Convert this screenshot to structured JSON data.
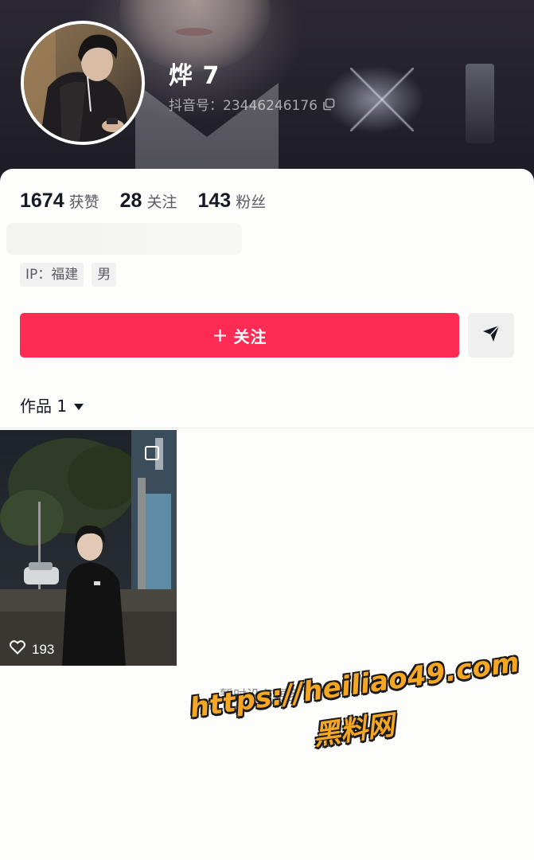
{
  "profile": {
    "nickname": "烨 7",
    "douyin_id": "抖音号：23446246176"
  },
  "stats": [
    {
      "value": "1674",
      "label": "获赞"
    },
    {
      "value": "28",
      "label": "关注"
    },
    {
      "value": "143",
      "label": "粉丝"
    }
  ],
  "tags": [
    "IP：福建",
    "男"
  ],
  "actions": {
    "follow_plus": "+",
    "follow_label": "关注"
  },
  "works_tab": {
    "label": "作品 1"
  },
  "works": [
    {
      "likes": "193"
    }
  ],
  "footer": {
    "end_text": "暂时没有更多了"
  },
  "watermark": {
    "url": "https://heiliao49.com",
    "name": "黑料网"
  },
  "colors": {
    "accent": "#fe2c55",
    "watermark": "#f5a623"
  },
  "icons": [
    "copy-icon",
    "share-icon",
    "caret-down-icon",
    "heart-icon",
    "pin-icon"
  ]
}
